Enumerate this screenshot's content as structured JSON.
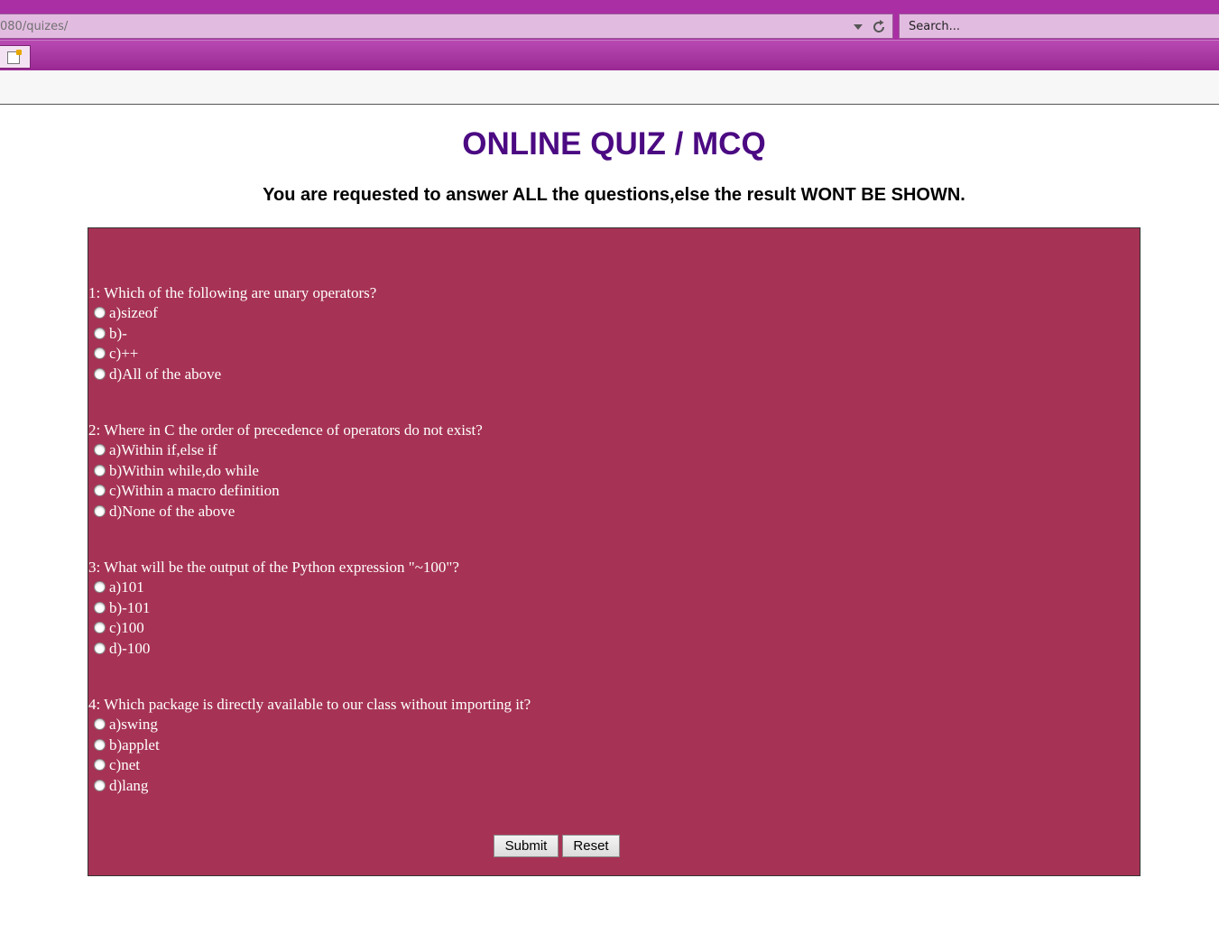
{
  "browser": {
    "url": "080/quizes/",
    "search_placeholder": "Search..."
  },
  "page": {
    "title": "ONLINE QUIZ / MCQ",
    "subtitle": "You are requested to answer ALL the questions,else the result WONT BE SHOWN."
  },
  "questions": [
    {
      "text": "1: Which of the following are unary operators?",
      "options": [
        "a)sizeof",
        "b)-",
        "c)++",
        "d)All of the above"
      ]
    },
    {
      "text": "2: Where in C the order of precedence of operators do not exist?",
      "options": [
        "a)Within if,else if",
        "b)Within while,do while",
        "c)Within a macro definition",
        "d)None of the above"
      ]
    },
    {
      "text": "3: What will be the output of the Python expression \"~100\"?",
      "options": [
        "a)101",
        "b)-101",
        "c)100",
        "d)-100"
      ]
    },
    {
      "text": "4: Which package is directly available to our class without importing it?",
      "options": [
        "a)swing",
        "b)applet",
        "c)net",
        "d)lang"
      ]
    }
  ],
  "buttons": {
    "submit_label": "Submit",
    "reset_label": "Reset"
  },
  "colors": {
    "chrome": "#aa2fa4",
    "quiz_background": "#a63355",
    "title": "#4b0a82"
  },
  "icons": {
    "reload": "reload-icon",
    "dropdown": "dropdown-arrow-icon",
    "tab": "new-tab-icon"
  }
}
